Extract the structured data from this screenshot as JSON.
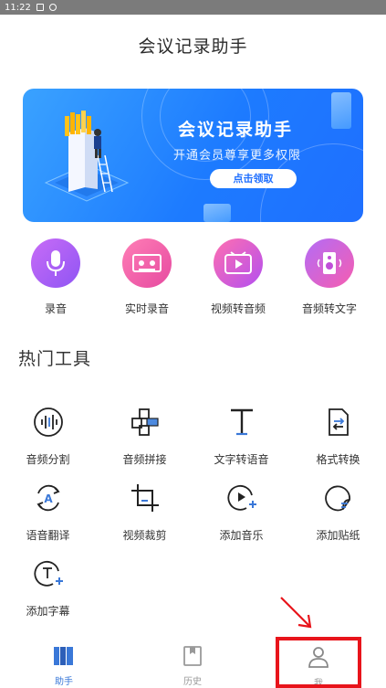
{
  "status_bar": {
    "time": "11:22"
  },
  "header": {
    "title": "会议记录助手"
  },
  "banner": {
    "title": "会议记录助手",
    "subtitle": "开通会员尊享更多权限",
    "button_label": "点击领取"
  },
  "quick_actions": [
    {
      "label": "录音",
      "icon": "microphone-icon"
    },
    {
      "label": "实时录音",
      "icon": "cassette-icon"
    },
    {
      "label": "视频转音频",
      "icon": "video-play-icon"
    },
    {
      "label": "音频转文字",
      "icon": "speaker-icon"
    }
  ],
  "tools_section": {
    "title": "热门工具",
    "tools": [
      {
        "label": "音频分割",
        "icon": "waveform-icon"
      },
      {
        "label": "音频拼接",
        "icon": "puzzle-join-icon"
      },
      {
        "label": "文字转语音",
        "icon": "text-t-icon"
      },
      {
        "label": "格式转换",
        "icon": "file-convert-icon"
      },
      {
        "label": "语音翻译",
        "icon": "translate-icon"
      },
      {
        "label": "视频裁剪",
        "icon": "crop-icon"
      },
      {
        "label": "添加音乐",
        "icon": "add-music-icon"
      },
      {
        "label": "添加贴纸",
        "icon": "sticker-icon"
      },
      {
        "label": "添加字幕",
        "icon": "add-subtitle-icon"
      }
    ]
  },
  "bottom_nav": {
    "items": [
      {
        "label": "助手",
        "active": true
      },
      {
        "label": "历史",
        "active": false
      },
      {
        "label": "我",
        "active": false
      }
    ]
  },
  "colors": {
    "accent": "#1f6fff",
    "highlight": "#e8141b",
    "nav_active": "#3a78d8"
  }
}
